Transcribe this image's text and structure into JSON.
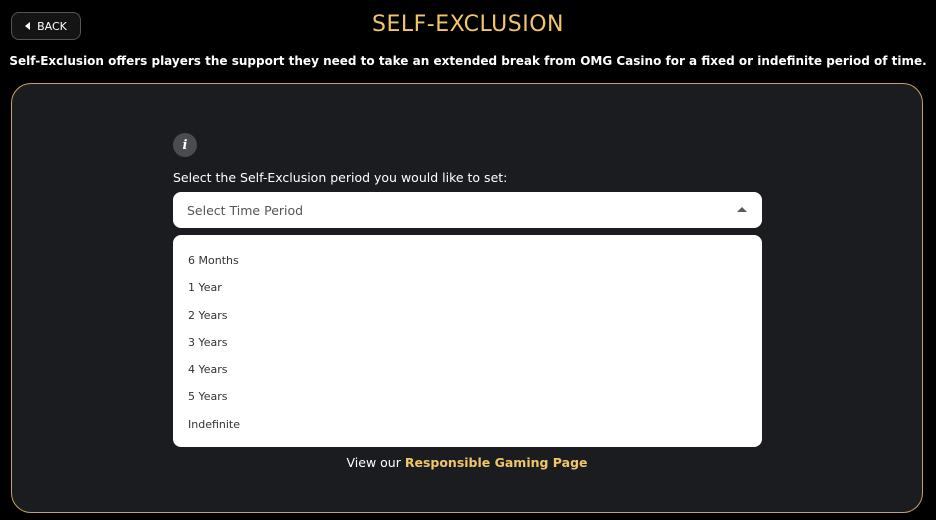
{
  "header": {
    "back_label": "BACK",
    "title": "SELF-EXCLUSION",
    "subtitle": "Self-Exclusion offers players the support they need to take an extended break from OMG Casino for a fixed or indefinite period of time."
  },
  "form": {
    "info_icon": "info-icon",
    "label": "Select the Self-Exclusion period you would like to set:",
    "select_placeholder": "Select Time Period",
    "options": [
      "6 Months",
      "1 Year",
      "2 Years",
      "3 Years",
      "4 Years",
      "5 Years",
      "Indefinite"
    ]
  },
  "footer": {
    "prefix": "View our",
    "link_label": "Responsible Gaming Page"
  },
  "colors": {
    "accent": "#f2c56b",
    "panel_border": "#c6a25a",
    "panel_bg": "#1b1c1f"
  }
}
